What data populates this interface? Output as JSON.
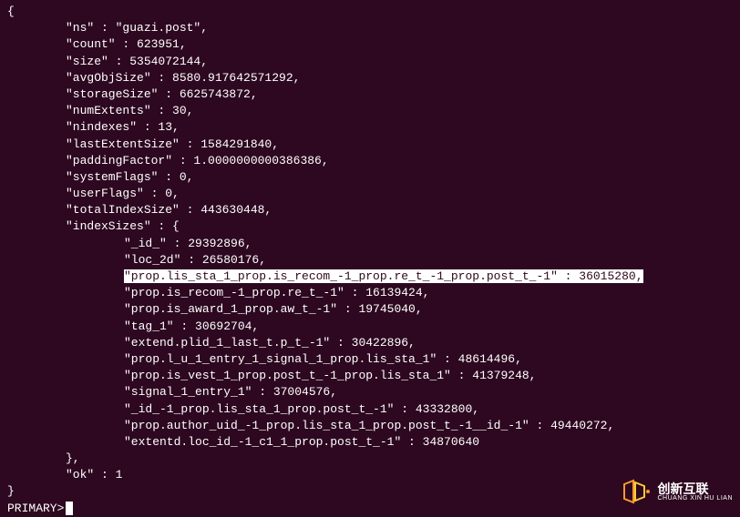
{
  "lines": {
    "open_brace": "{",
    "ns": "\"ns\" : \"guazi.post\",",
    "count": "\"count\" : 623951,",
    "size": "\"size\" : 5354072144,",
    "avgObjSize": "\"avgObjSize\" : 8580.917642571292,",
    "storageSize": "\"storageSize\" : 6625743872,",
    "numExtents": "\"numExtents\" : 30,",
    "nindexes": "\"nindexes\" : 13,",
    "lastExtentSize": "\"lastExtentSize\" : 1584291840,",
    "paddingFactor": "\"paddingFactor\" : 1.0000000000386386,",
    "systemFlags": "\"systemFlags\" : 0,",
    "userFlags": "\"userFlags\" : 0,",
    "totalIndexSize": "\"totalIndexSize\" : 443630448,",
    "indexSizes_open": "\"indexSizes\" : {",
    "idx_id": "\"_id_\" : 29392896,",
    "idx_loc2d": "\"loc_2d\" : 26580176,",
    "idx_highlighted": "\"prop.lis_sta_1_prop.is_recom_-1_prop.re_t_-1_prop.post_t_-1\" : 36015280,",
    "idx_recom": "\"prop.is_recom_-1_prop.re_t_-1\" : 16139424,",
    "idx_award": "\"prop.is_award_1_prop.aw_t_-1\" : 19745040,",
    "idx_tag": "\"tag_1\" : 30692704,",
    "idx_extend_plid": "\"extend.plid_1_last_t.p_t_-1\" : 30422896,",
    "idx_lu": "\"prop.l_u_1_entry_1_signal_1_prop.lis_sta_1\" : 48614496,",
    "idx_vest": "\"prop.is_vest_1_prop.post_t_-1_prop.lis_sta_1\" : 41379248,",
    "idx_signal": "\"signal_1_entry_1\" : 37004576,",
    "idx_id_lis": "\"_id_-1_prop.lis_sta_1_prop.post_t_-1\" : 43332800,",
    "idx_author": "\"prop.author_uid_-1_prop.lis_sta_1_prop.post_t_-1__id_-1\" : 49440272,",
    "idx_extentd": "\"extentd.loc_id_-1_c1_1_prop.post_t_-1\" : 34870640",
    "indexSizes_close": "},",
    "ok": "\"ok\" : 1",
    "close_brace": "}",
    "prompt": "PRIMARY> "
  },
  "watermark": {
    "main": "创新互联",
    "sub": "CHUANG XIN HU LIAN"
  }
}
